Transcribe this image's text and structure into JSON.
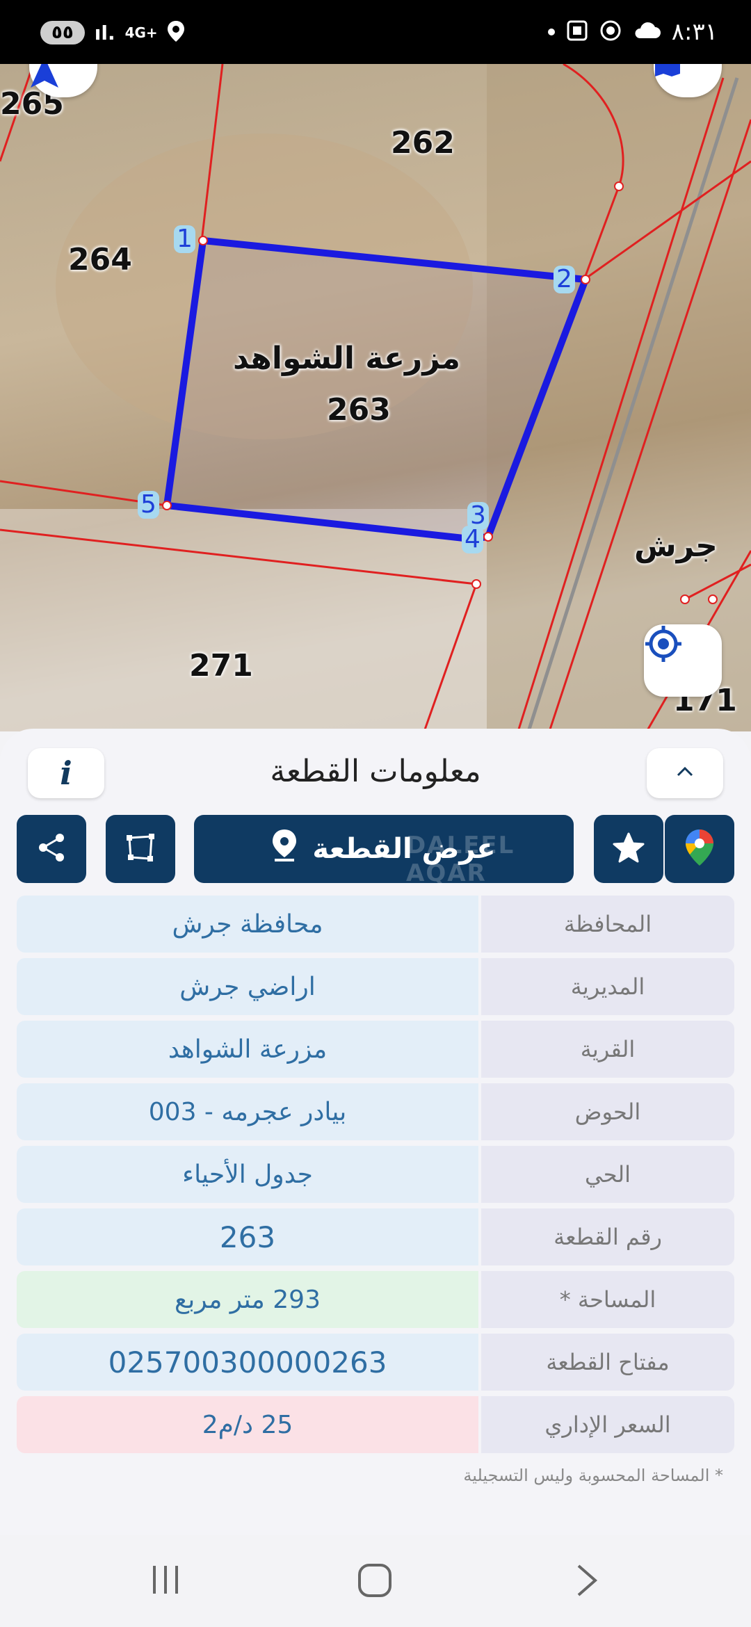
{
  "status_bar": {
    "pill": "٥٥",
    "network": "4G+",
    "time": "٨:٣١"
  },
  "map": {
    "parcels": {
      "p265": "265",
      "p262": "262",
      "p264": "264",
      "p263": "263",
      "p271": "271",
      "p171": "171"
    },
    "parcel_name": "مزرعة الشواهد",
    "place_label": "جرش",
    "vertices": [
      "1",
      "2",
      "3",
      "4",
      "5"
    ]
  },
  "sheet": {
    "title": "معلومات القطعة",
    "info_label": "i",
    "show_parcel_label": "عرض القطعة",
    "watermark": "DALEEL AQAR"
  },
  "details": [
    {
      "label": "المحافظة",
      "value": "محافظة جرش"
    },
    {
      "label": "المديرية",
      "value": "اراضي جرش"
    },
    {
      "label": "القرية",
      "value": "مزرعة الشواهد"
    },
    {
      "label": "الحوض",
      "value": "بيادر عجرمه - 003"
    },
    {
      "label": "الحي",
      "value": "جدول الأحياء"
    },
    {
      "label": "رقم القطعة",
      "value": "263"
    },
    {
      "label": "المساحة *",
      "value": "293  متر مربع"
    },
    {
      "label": "مفتاح القطعة",
      "value": "025700300000263"
    },
    {
      "label": "السعر الإداري",
      "value": "25 د/م2"
    }
  ],
  "footnote": "* المساحة المحسوبة وليس التسجيلية",
  "colors": {
    "accent": "#0f3a62",
    "parcel_outline": "#1a1ae0",
    "boundary": "#e02020"
  },
  "icons": [
    "navigation-arrow-icon",
    "layers-icon",
    "locate-icon",
    "share-icon",
    "polygon-icon",
    "location-pin-icon",
    "star-icon",
    "google-maps-icon",
    "chevron-up-icon",
    "recents-icon",
    "home-icon",
    "back-icon"
  ]
}
